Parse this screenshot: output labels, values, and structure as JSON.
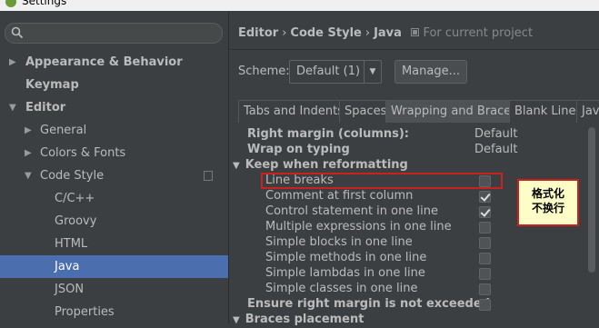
{
  "window": {
    "title": "Settings"
  },
  "sidebar": {
    "search_placeholder": "",
    "items": [
      {
        "label": "Appearance & Behavior",
        "arrow": "▶"
      },
      {
        "label": "Keymap",
        "arrow": ""
      },
      {
        "label": "Editor",
        "arrow": "▼"
      },
      {
        "label": "General",
        "arrow": "▶"
      },
      {
        "label": "Colors & Fonts",
        "arrow": "▶"
      },
      {
        "label": "Code Style",
        "arrow": "▼"
      },
      {
        "label": "C/C++",
        "arrow": ""
      },
      {
        "label": "Groovy",
        "arrow": ""
      },
      {
        "label": "HTML",
        "arrow": ""
      },
      {
        "label": "Java",
        "arrow": ""
      },
      {
        "label": "JSON",
        "arrow": ""
      },
      {
        "label": "Properties",
        "arrow": ""
      }
    ]
  },
  "breadcrumb": {
    "part1": "Editor",
    "sep": "›",
    "part2": "Code Style",
    "part3": "Java",
    "project": "For current project"
  },
  "scheme": {
    "label": "Scheme:",
    "value": "Default (1)",
    "manage_label": "Manage..."
  },
  "tabs": [
    "Tabs and Indents",
    "Spaces",
    "Wrapping and Braces",
    "Blank Lines",
    "Jav"
  ],
  "options": {
    "right_margin": {
      "label": "Right margin (columns):",
      "value": "Default"
    },
    "wrap_on_typing": {
      "label": "Wrap on typing",
      "value": "Default"
    },
    "keep_group": {
      "label": "Keep when reformatting",
      "arrow": "▼"
    },
    "keep_items": [
      {
        "label": "Line breaks",
        "checked": false
      },
      {
        "label": "Comment at first column",
        "checked": true
      },
      {
        "label": "Control statement in one line",
        "checked": true
      },
      {
        "label": "Multiple expressions in one line",
        "checked": false
      },
      {
        "label": "Simple blocks in one line",
        "checked": false
      },
      {
        "label": "Simple methods in one line",
        "checked": false
      },
      {
        "label": "Simple lambdas in one line",
        "checked": false
      },
      {
        "label": "Simple classes in one line",
        "checked": false
      }
    ],
    "ensure_margin": {
      "label": "Ensure right margin is not exceeded",
      "checked": false
    },
    "braces": {
      "label": "Braces placement",
      "arrow": "▼"
    }
  },
  "annotation": {
    "line1": "格式化",
    "line2": "不换行"
  },
  "colors": {
    "accent_selection": "#4b6eaf",
    "highlight_box": "#cc1f1f",
    "note_bg": "#fdfdc7"
  }
}
